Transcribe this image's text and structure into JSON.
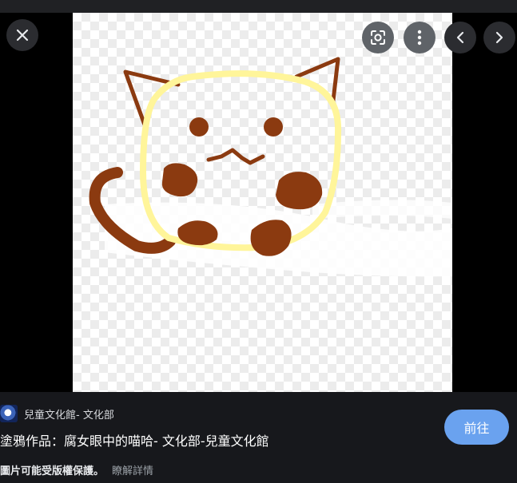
{
  "viewer": {
    "close_icon": "close-icon",
    "lens_icon": "google-lens-icon",
    "more_icon": "more-vert-icon",
    "prev_icon": "chevron-left-icon",
    "next_icon": "chevron-right-icon"
  },
  "image": {
    "subject": "cat-doodle",
    "colors": {
      "outline": "#fff59a",
      "spots": "#8b3a10",
      "background": "#ffffff"
    }
  },
  "footer": {
    "source_name": "兒童文化館- 文化部",
    "title": "塗鴉作品：腐女眼中的喵哈- 文化部-兒童文化館",
    "copyright_notice": "圖片可能受版權保護。",
    "learn_more": "瞭解詳情",
    "visit_label": "前往"
  },
  "colors": {
    "accent": "#6aa2ef",
    "background": "#17181c"
  }
}
